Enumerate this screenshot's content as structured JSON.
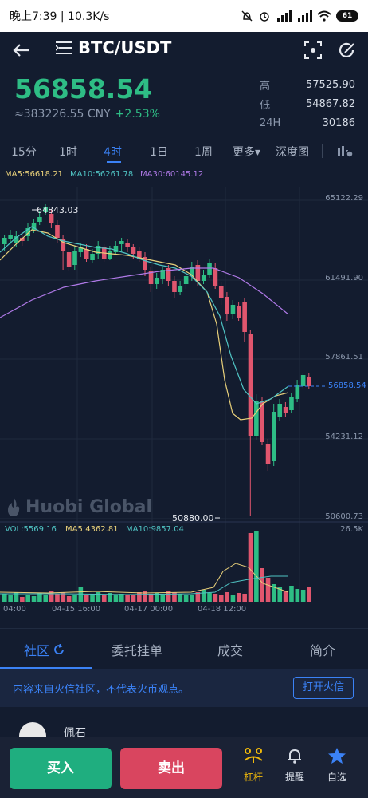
{
  "status_bar": {
    "time": "晚上7:39 | 10.3K/s",
    "battery": "61"
  },
  "header": {
    "pair": "BTC/USDT"
  },
  "price": {
    "last": "56858.54",
    "cny": "≈383226.55 CNY",
    "change": "+2.53%"
  },
  "stats": [
    {
      "k": "高",
      "v": "57525.90"
    },
    {
      "k": "低",
      "v": "54867.82"
    },
    {
      "k": "24H",
      "v": "30186"
    }
  ],
  "intervals": [
    "15分",
    "1时",
    "4时",
    "1日",
    "1周",
    "更多▾",
    "深度图"
  ],
  "active_interval": "4时",
  "chart_data": {
    "type": "candlestick",
    "legend": {
      "ma5": "MA5:56618.21",
      "ma10": "MA10:56261.78",
      "ma30": "MA30:60145.12"
    },
    "y_ticks": [
      "65122.29",
      "61491.90",
      "57861.51",
      "54231.12",
      "50600.73"
    ],
    "high_label": "64843.03",
    "low_label": "50880.00",
    "last_price_label": "56858.54",
    "colors": {
      "up": "#2ebd85",
      "down": "#e0566e",
      "ma5": "#e8d07a",
      "ma10": "#4fc3c3",
      "ma30": "#b07ae8"
    },
    "volume_legend": {
      "vol": "VOL:5569.16",
      "ma5": "MA5:4362.81",
      "ma10": "MA10:9857.04"
    },
    "volume_max": "26.5K",
    "x_ticks": [
      "04:00",
      "04-15 16:00",
      "04-17 00:00",
      "04-18 12:00"
    ]
  },
  "watermark": "Huobi Global",
  "bottom_tabs": [
    "社区",
    "委托挂单",
    "成交",
    "简介"
  ],
  "notice": {
    "text": "内容来自火信社区，不代表火币观点。",
    "button": "打开火信"
  },
  "user_peek": "佩石",
  "footer": {
    "buy": "买入",
    "sell": "卖出",
    "leverage": "杠杆",
    "alert": "提醒",
    "favorite": "自选"
  }
}
